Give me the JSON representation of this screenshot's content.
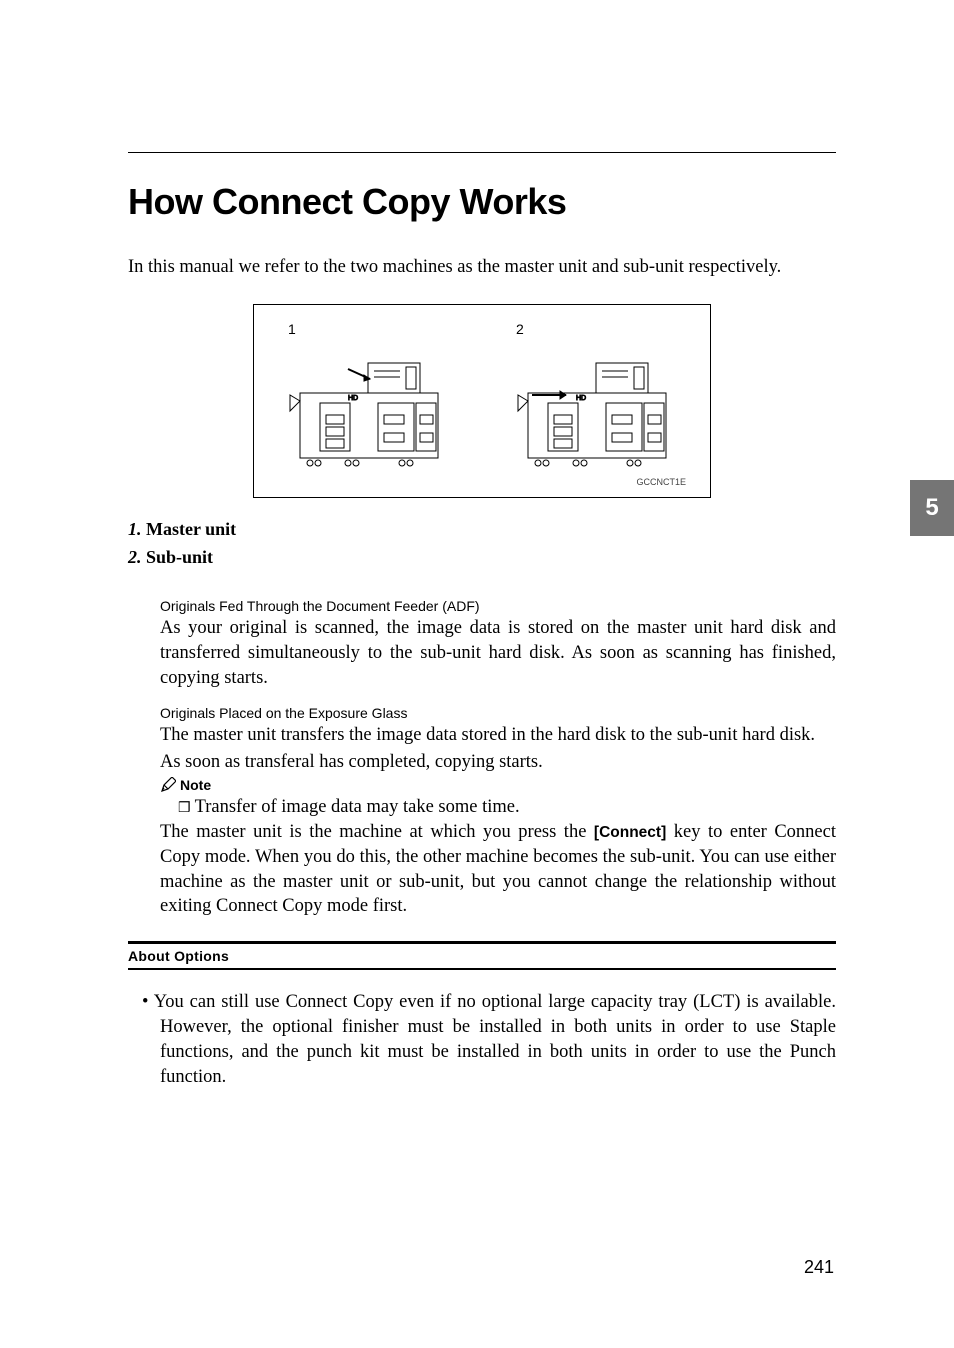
{
  "title": "How Connect Copy Works",
  "intro": "In this manual we refer to the two machines as the master unit and sub-unit respectively.",
  "figure": {
    "num1": "1",
    "num2": "2",
    "caption_id": "GCCNCT1E"
  },
  "list": {
    "item1_num": "1.",
    "item1_label": " Master unit",
    "item2_num": "2.",
    "item2_label": " Sub-unit"
  },
  "section_a": {
    "heading": "Originals Fed Through the Document Feeder (ADF)",
    "body": "As your original is scanned, the image data is stored on the master unit hard disk and transferred simultaneously to the sub-unit hard disk. As soon as scanning has finished, copying starts."
  },
  "section_b": {
    "heading": "Originals Placed on the Exposure Glass",
    "body1": "The master unit transfers the image data stored in the hard disk to the sub-unit hard disk.",
    "body2": "As soon as transferal has completed, copying starts."
  },
  "note": {
    "label": "Note",
    "check": "❒",
    "entry": "Transfer of image data may take some time."
  },
  "para3_pre": "The master unit is the machine at which you press the ",
  "para3_key": "[Connect]",
  "para3_post": " key to enter Connect Copy mode. When you do this, the other machine becomes the sub-unit. You can use either machine as the master unit or sub-unit, but you cannot change the relationship without exiting Connect Copy mode first.",
  "options": {
    "heading": "About Options",
    "bullet": "•  You can still use Connect Copy even if no optional large capacity tray (LCT) is available. However, the optional finisher must be installed in both units in order to use Staple functions, and the punch kit must be installed in both units in order to use the Punch function."
  },
  "page_number": "241",
  "side_tab": "5"
}
